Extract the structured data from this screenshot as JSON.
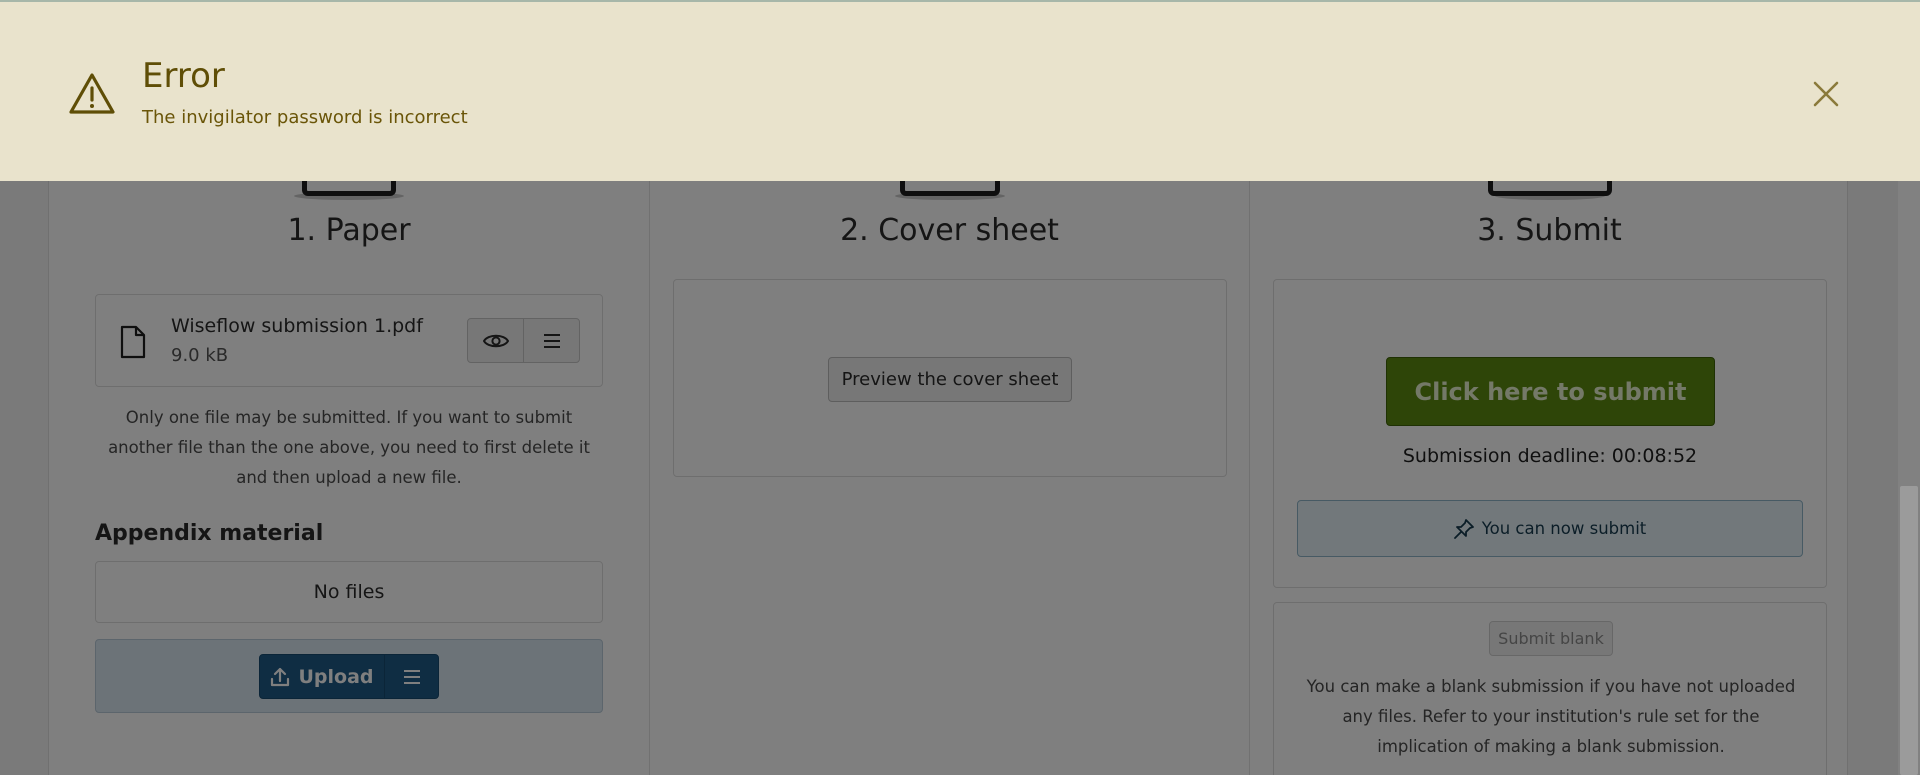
{
  "error": {
    "title": "Error",
    "message": "The invigilator password is incorrect"
  },
  "steps": {
    "paper": {
      "title": "1. Paper",
      "file": {
        "name": "Wiseflow submission 1.pdf",
        "size": "9.0 kB"
      },
      "note": "Only one file may be submitted. If you want to submit another file than the one above, you need to first delete it and then upload a new file.",
      "appendix_heading": "Appendix material",
      "no_files": "No files",
      "upload_label": "Upload"
    },
    "cover": {
      "title": "2. Cover sheet",
      "preview_label": "Preview the cover sheet"
    },
    "submit": {
      "title": "3. Submit",
      "submit_label": "Click here to submit",
      "deadline": "Submission deadline: 00:08:52",
      "status": "You can now submit",
      "blank_label": "Submit blank",
      "blank_text": "You can make a blank submission if you have not uploaded any files. Refer to your institution's rule set for the implication of making a blank submission."
    }
  },
  "colors": {
    "banner_bg": "#e9e3cc",
    "banner_text": "#5f4e06",
    "submit_button": "#5c8a10",
    "upload_button": "#1e5a86"
  },
  "icons": {
    "error": "warning-triangle-icon",
    "close": "close-icon",
    "file": "document-icon",
    "preview": "eye-icon",
    "menu": "hamburger-menu-icon",
    "upload": "upload-arrow-icon",
    "pin": "pin-icon"
  }
}
